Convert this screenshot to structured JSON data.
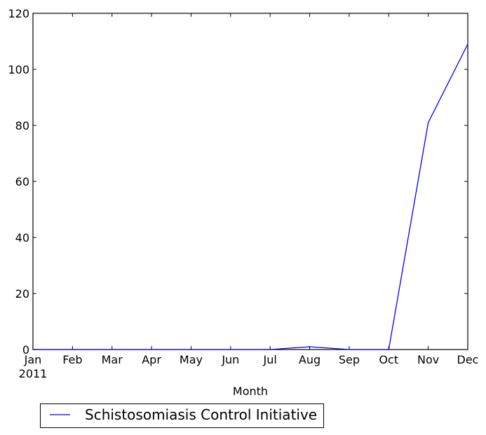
{
  "chart_data": {
    "type": "line",
    "title": "",
    "xlabel": "Month",
    "ylabel": "",
    "categories": [
      "Jan",
      "Feb",
      "Mar",
      "Apr",
      "May",
      "Jun",
      "Jul",
      "Aug",
      "Sep",
      "Oct",
      "Nov",
      "Dec"
    ],
    "x_sublabel": "2011",
    "series": [
      {
        "name": "Schistosomiasis Control Initiative",
        "color": "#0000ff",
        "values": [
          0,
          0,
          0,
          0,
          0,
          0,
          0,
          1,
          0,
          0,
          81,
          109
        ]
      }
    ],
    "ylim": [
      0,
      120
    ],
    "yticks": [
      0,
      20,
      40,
      60,
      80,
      100,
      120
    ],
    "grid": false,
    "legend_position": "bottom-left, below axes"
  }
}
